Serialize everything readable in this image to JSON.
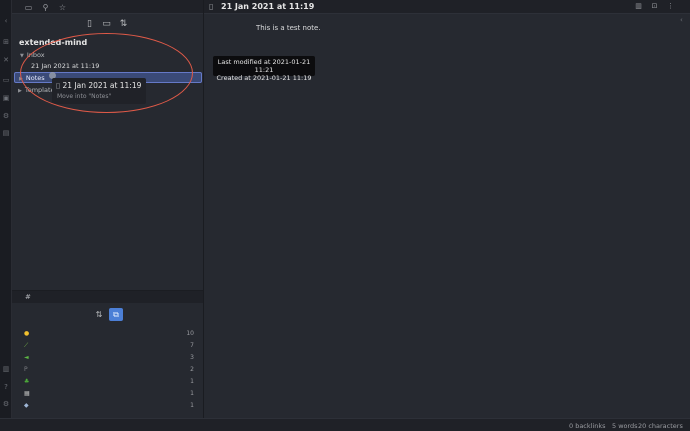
{
  "ribbon": {
    "icons": [
      "chevron-left-icon",
      "graph-icon",
      "shuffle-icon",
      "calendar-icon",
      "file-icon",
      "plugin-icon",
      "template-icon",
      "vault-icon",
      "help-icon",
      "settings-icon"
    ]
  },
  "sidebar": {
    "top_icons": [
      "folder-icon",
      "search-icon",
      "star-icon"
    ],
    "toolbar": [
      "new-note-icon",
      "new-folder-icon",
      "sort-icon"
    ],
    "vault_name": "extended-mind",
    "tree": {
      "inbox": "Inbox",
      "inbox_file": "21 Jan 2021 at 11:19",
      "notes": "Notes",
      "templates": "Templates"
    },
    "drag": {
      "file": "21 Jan 2021 at 11:19",
      "hint": "Move into \"Notes\""
    }
  },
  "tags": {
    "tab": "#",
    "rows": [
      {
        "icon": "yellow-circle-emoji",
        "glyph": "●",
        "color": "#f2c12e",
        "count": "10"
      },
      {
        "icon": "seedling-emoji",
        "glyph": "⟋",
        "color": "#7bc04a",
        "count": "7"
      },
      {
        "icon": "leaf-emoji",
        "glyph": "◄",
        "color": "#5db844",
        "count": "3"
      },
      {
        "icon": "p-emoji",
        "glyph": "P",
        "color": "#7a7c80",
        "count": "2"
      },
      {
        "icon": "tree-emoji",
        "glyph": "♣",
        "color": "#4caa3a",
        "count": "1"
      },
      {
        "icon": "building-emoji",
        "glyph": "▦",
        "color": "#b8b8b8",
        "count": "1"
      },
      {
        "icon": "gem-emoji",
        "glyph": "◆",
        "color": "#9fb6d6",
        "count": "1"
      }
    ]
  },
  "main": {
    "title": "21 Jan 2021 at 11:19",
    "body": "This is a test note.",
    "tooltip_modified": "Last modified at 2021-01-21 11:21",
    "tooltip_created": "Created at 2021-01-21 11:19"
  },
  "status": {
    "backlinks": "0 backlinks",
    "words": "5 words",
    "characters": "20 characters"
  },
  "colors": {
    "accent": "#4c7fd6",
    "highlight": "#3a4a78",
    "annotation": "#e05a48"
  }
}
